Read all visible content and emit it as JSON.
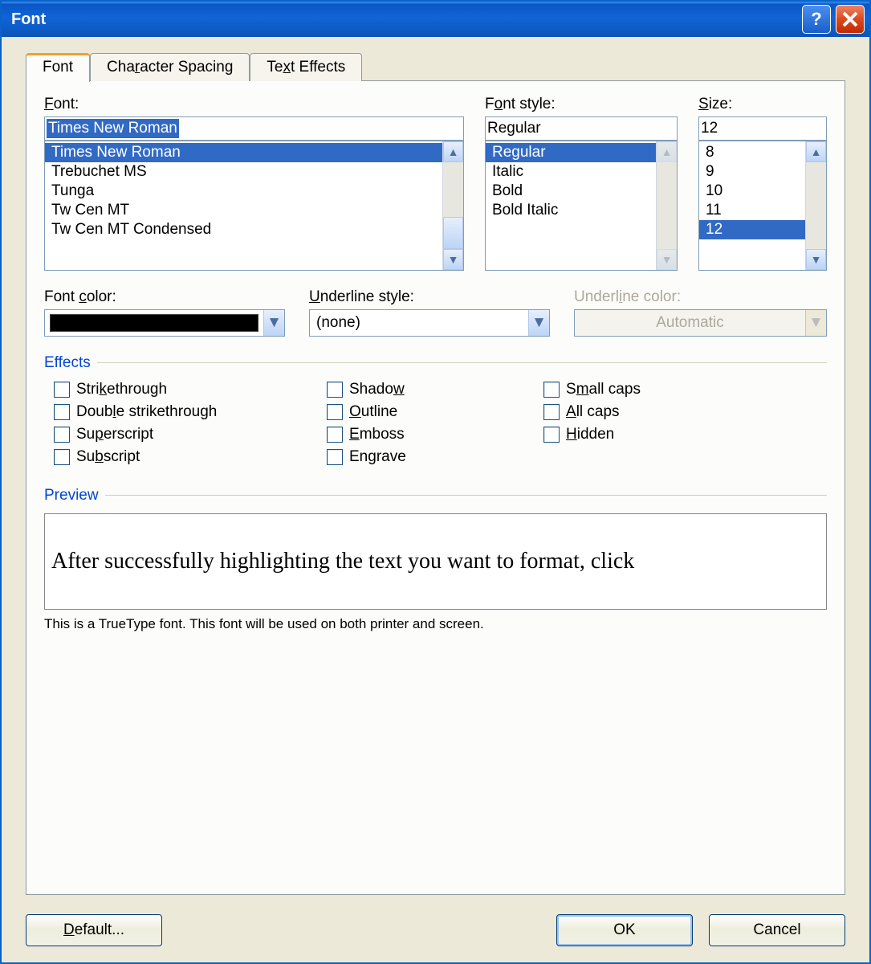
{
  "title": "Font",
  "tabs": {
    "font": "Font",
    "spacing": "Character Spacing",
    "effects": "Text Effects"
  },
  "font_panel": {
    "font_label": "Font:",
    "font_value": "Times New Roman",
    "font_list": [
      "Times New Roman",
      "Trebuchet MS",
      "Tunga",
      "Tw Cen MT",
      "Tw Cen MT Condensed"
    ],
    "style_label": "Font style:",
    "style_value": "Regular",
    "style_list": [
      "Regular",
      "Italic",
      "Bold",
      "Bold Italic"
    ],
    "size_label": "Size:",
    "size_value": "12",
    "size_list": [
      "8",
      "9",
      "10",
      "11",
      "12"
    ],
    "font_color_label": "Font color:",
    "underline_style_label": "Underline style:",
    "underline_style_value": "(none)",
    "underline_color_label": "Underline color:",
    "underline_color_value": "Automatic"
  },
  "effects": {
    "title": "Effects",
    "col1": [
      "Strikethrough",
      "Double strikethrough",
      "Superscript",
      "Subscript"
    ],
    "col2": [
      "Shadow",
      "Outline",
      "Emboss",
      "Engrave"
    ],
    "col3": [
      "Small caps",
      "All caps",
      "Hidden"
    ]
  },
  "preview": {
    "title": "Preview",
    "text": "After successfully highlighting the text you want to format, click",
    "note": "This is a TrueType font. This font will be used on both printer and screen."
  },
  "buttons": {
    "default": "Default...",
    "ok": "OK",
    "cancel": "Cancel"
  }
}
